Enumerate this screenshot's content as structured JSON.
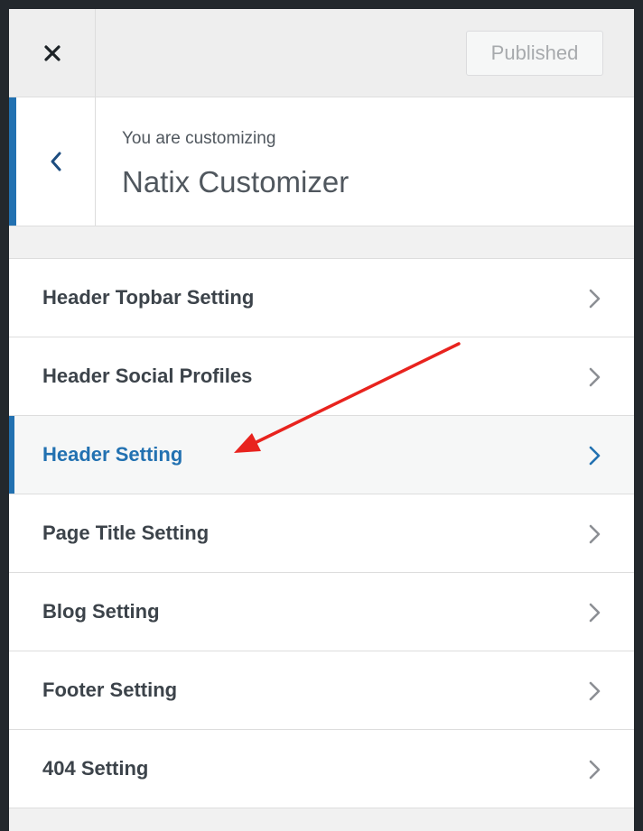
{
  "header": {
    "published_label": "Published"
  },
  "info": {
    "subtitle": "You are customizing",
    "title": "Natix Customizer"
  },
  "sections": [
    {
      "label": "Header Topbar Setting",
      "active": false
    },
    {
      "label": "Header Social Profiles",
      "active": false
    },
    {
      "label": "Header Setting",
      "active": true
    },
    {
      "label": "Page Title Setting",
      "active": false
    },
    {
      "label": "Blog Setting",
      "active": false
    },
    {
      "label": "Footer Setting",
      "active": false
    },
    {
      "label": "404 Setting",
      "active": false
    }
  ],
  "colors": {
    "accent": "#2271b1",
    "annotation_arrow": "#e8231e"
  },
  "icons": {
    "close": "close-icon",
    "back": "chevron-left-icon",
    "section": "chevron-right-icon",
    "annotation": "red-arrow-annotation"
  }
}
